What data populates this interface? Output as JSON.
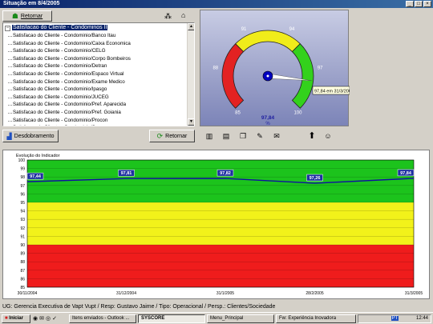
{
  "window": {
    "title": "Situação em 8/4/2005",
    "controls": [
      "_",
      "□",
      "×"
    ]
  },
  "toolbar": {
    "back_label": "Retornar"
  },
  "tree": {
    "root": "Satisfacao do Cliente - Condominos II",
    "items": [
      "Satisfacao do Cliente - Condominio/Banco Itau",
      "Satisfacao do Cliente - Condominio/Caixa Economica",
      "Satisfacao do Cliente - Condominio/CELG",
      "Satisfacao do Cliente - Condominio/Corpo Bombeiros",
      "Satisfacao do Cliente - Condominio/Detran",
      "Satisfacao do Cliente - Condominio/Espaco Virtual",
      "Satisfacao do Cliente - Condominio/Exame Medico",
      "Satisfacao do Cliente - Condominio/Ipasgo",
      "Satisfacao do Cliente - Condominio/JUCEG",
      "Satisfacao do Cliente - Condominio/Pref. Aparecida",
      "Satisfacao do Cliente - Condominio/Pref. Goiania",
      "Satisfacao do Cliente - Condominio/Procon",
      "Satisfacao do Cliente - Condominio/Sanecan"
    ]
  },
  "buttons": {
    "drilldown_label": "Desdobramento",
    "return_label": "Retornar"
  },
  "gauge": {
    "min": 85,
    "max": 100,
    "value": 97.84,
    "value_text": "97,84",
    "unit": "%",
    "tooltip": "97,84 em 31/3/2005",
    "ticks": [
      "85",
      "88",
      "91",
      "94",
      "97",
      "100"
    ],
    "colors": {
      "red": "#e32222",
      "yellow": "#f0ec1a",
      "green": "#33d11c",
      "needle": "#ffffff",
      "hub": "#0000c0"
    }
  },
  "chart_data": {
    "type": "line",
    "title": "Evolução do Indicador",
    "categories": [
      "30/11/2004",
      "31/12/2004",
      "31/1/2005",
      "28/2/2005",
      "31/3/2005"
    ],
    "x_positions": [
      0,
      31,
      62,
      90,
      121
    ],
    "series": [
      {
        "values": [
          97.44,
          97.81,
          97.82,
          97.26,
          97.84
        ]
      }
    ],
    "value_labels": [
      "97,44",
      "97,81",
      "97,82",
      "97,26",
      "97,84"
    ],
    "ylim": [
      85,
      100
    ],
    "yticks": [
      85,
      86,
      87,
      88,
      89,
      90,
      91,
      92,
      93,
      94,
      95,
      96,
      97,
      98,
      99,
      100
    ],
    "bands": [
      {
        "from": 85,
        "to": 90,
        "color": "#ef1c1c"
      },
      {
        "from": 90,
        "to": 95,
        "color": "#f2f21a"
      },
      {
        "from": 95,
        "to": 100,
        "color": "#1cc31c"
      }
    ],
    "line_color": "#1010a0"
  },
  "status": "UG: Gerencia Executiva de Vapt Vupt / Resp: Gustavo Jaime / Tipo: Operacional / Persp.: Clientes/Sociedade",
  "taskbar": {
    "start_label": "Iniciar",
    "tasks": [
      "Itens enviados - Outlook ...",
      "SYSCORE",
      "Menu_Principal",
      "Fw: Experiência Inovadora"
    ],
    "clock": "12:44",
    "tray_label": "PT"
  }
}
